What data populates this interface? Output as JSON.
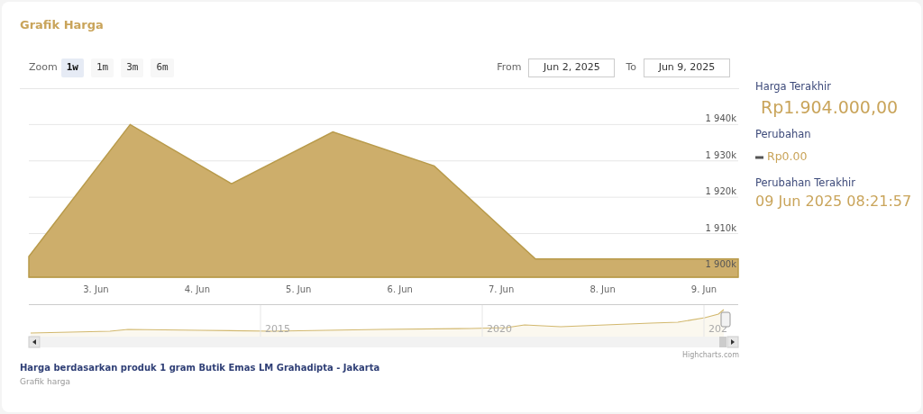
{
  "title": "Grafik Harga",
  "toolbar": {
    "zoom_label": "Zoom",
    "zoom_buttons": [
      {
        "label": "1w",
        "selected": true
      },
      {
        "label": "1m",
        "selected": false
      },
      {
        "label": "3m",
        "selected": false
      },
      {
        "label": "6m",
        "selected": false
      }
    ],
    "from_label": "From",
    "from_value": "Jun 2, 2025",
    "to_label": "To",
    "to_value": "Jun 9, 2025"
  },
  "chart_data": {
    "type": "area",
    "categories": [
      null,
      "3. Jun",
      "4. Jun",
      "5. Jun",
      "6. Jun",
      "7. Jun",
      "8. Jun",
      "9. Jun"
    ],
    "series": [
      {
        "color": "#cdae6b",
        "values": [
          1903.7,
          1940,
          1923.7,
          1938,
          1928.6,
          1903,
          1903,
          1903
        ]
      }
    ],
    "grid": true,
    "ylim": [
      1898,
      1950
    ],
    "yticks": [
      {
        "value": 1900,
        "label": "1 900k"
      },
      {
        "value": 1910,
        "label": "1 910k"
      },
      {
        "value": 1920,
        "label": "1 920k"
      },
      {
        "value": 1930,
        "label": "1 930k"
      },
      {
        "value": 1940,
        "label": "1 940k"
      }
    ]
  },
  "navigator": {
    "year_labels": [
      "2015",
      "2020",
      "202"
    ]
  },
  "credits": "Highcharts.com",
  "caption": "Harga berdasarkan produk 1 gram Butik Emas LM Grahadipta - Jakarta",
  "subcaption": "Grafik harga",
  "summary": {
    "last_price_label": "Harga Terakhir",
    "last_price": "Rp1.904.000,00",
    "change_label": "Perubahan",
    "change": "Rp0.00",
    "unchanged": true,
    "last_change_label": "Perubahan Terakhir",
    "last_change": "09 Jun 2025 08:21:57"
  }
}
